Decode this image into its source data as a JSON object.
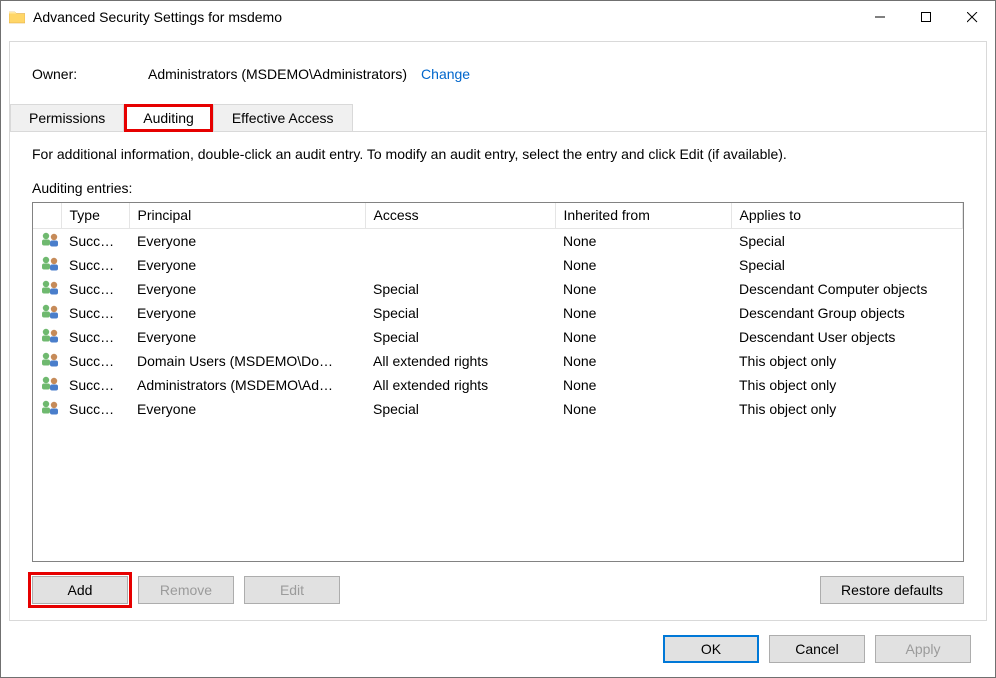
{
  "window": {
    "title": "Advanced Security Settings for msdemo"
  },
  "owner": {
    "label": "Owner:",
    "value": "Administrators (MSDEMO\\Administrators)",
    "change": "Change"
  },
  "tabs": {
    "permissions": "Permissions",
    "auditing": "Auditing",
    "effective": "Effective Access"
  },
  "info": "For additional information, double-click an audit entry. To modify an audit entry, select the entry and click Edit (if available).",
  "entries_label": "Auditing entries:",
  "columns": {
    "type": "Type",
    "principal": "Principal",
    "access": "Access",
    "inherited": "Inherited from",
    "applies": "Applies to"
  },
  "rows": [
    {
      "type": "Succ…",
      "principal": "Everyone",
      "access": "",
      "inherited": "None",
      "applies": "Special"
    },
    {
      "type": "Succ…",
      "principal": "Everyone",
      "access": "",
      "inherited": "None",
      "applies": "Special"
    },
    {
      "type": "Succ…",
      "principal": "Everyone",
      "access": "Special",
      "inherited": "None",
      "applies": "Descendant Computer objects"
    },
    {
      "type": "Succ…",
      "principal": "Everyone",
      "access": "Special",
      "inherited": "None",
      "applies": "Descendant Group objects"
    },
    {
      "type": "Succ…",
      "principal": "Everyone",
      "access": "Special",
      "inherited": "None",
      "applies": "Descendant User objects"
    },
    {
      "type": "Succ…",
      "principal": "Domain Users (MSDEMO\\Do…",
      "access": "All extended rights",
      "inherited": "None",
      "applies": "This object only"
    },
    {
      "type": "Succ…",
      "principal": "Administrators (MSDEMO\\Ad…",
      "access": "All extended rights",
      "inherited": "None",
      "applies": "This object only"
    },
    {
      "type": "Succ…",
      "principal": "Everyone",
      "access": "Special",
      "inherited": "None",
      "applies": "This object only"
    }
  ],
  "buttons": {
    "add": "Add",
    "remove": "Remove",
    "edit": "Edit",
    "restore": "Restore defaults",
    "ok": "OK",
    "cancel": "Cancel",
    "apply": "Apply"
  }
}
